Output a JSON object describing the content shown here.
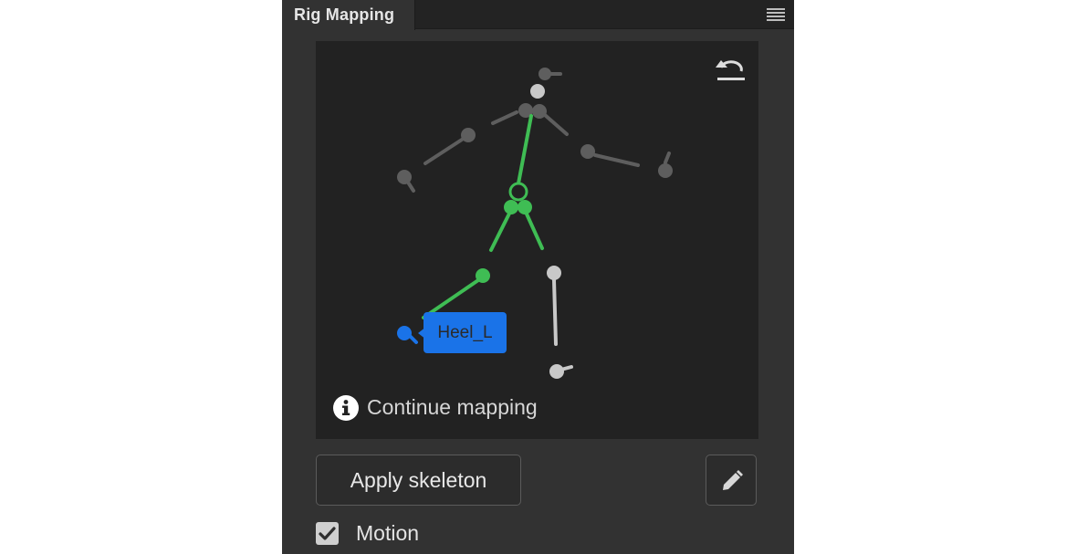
{
  "panel": {
    "tab_title": "Rig Mapping",
    "menu_icon": "hamburger-menu-icon"
  },
  "viewport": {
    "undo_icon": "undo-icon",
    "selected_joint_tooltip": "Heel_L",
    "hint_icon": "info-icon",
    "hint_text": "Continue mapping",
    "colors": {
      "mapped": "#3fbd54",
      "unmapped_dark": "#5e5e5e",
      "unmapped_light": "#c8c8c8",
      "selected": "#1a73e8"
    }
  },
  "actions": {
    "apply_label": "Apply skeleton",
    "edit_icon": "pencil-icon"
  },
  "options": {
    "motion_label": "Motion",
    "motion_checked": true
  }
}
